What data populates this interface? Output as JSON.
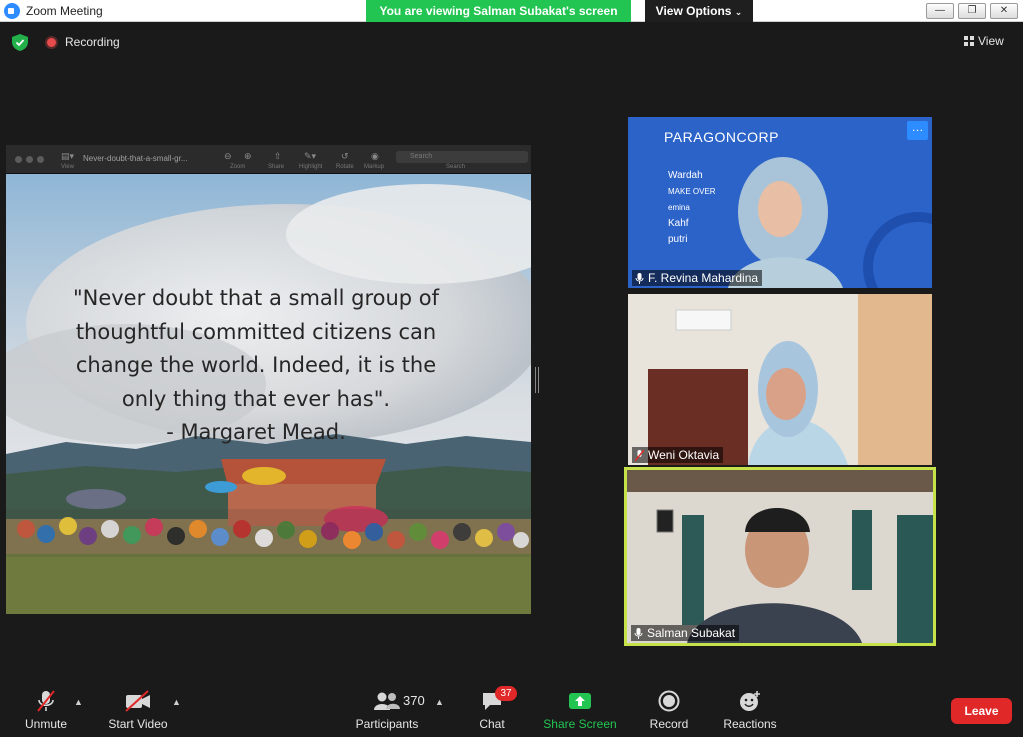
{
  "window": {
    "title": "Zoom Meeting",
    "banner": "You are viewing Salman Subakat's screen",
    "view_options": "View Options",
    "controls": {
      "minimize": "—",
      "restore": "❐",
      "close": "✕"
    }
  },
  "status": {
    "recording": "Recording",
    "view": "View"
  },
  "shared_screen": {
    "filename": "Never-doubt-that-a-small-gr...",
    "toolbar": [
      "View",
      "Zoom",
      "Share",
      "Highlight",
      "Rotate",
      "Markup"
    ],
    "search_placeholder": "Search",
    "search_label": "Search",
    "quote_lines": [
      "\"Never doubt that a small group of",
      "thoughtful committed citizens can",
      "change the world.  Indeed, it is the",
      "only thing that ever has\".",
      "- Margaret Mead."
    ]
  },
  "participants": [
    {
      "name": "F. Revina Mahardina",
      "brand": "PARAGONCORP",
      "brand_list": [
        "Wardah",
        "MAKE OVER",
        "emina",
        "Kahf",
        "putri"
      ]
    },
    {
      "name": "Weni Oktavia"
    },
    {
      "name": "Salman Subakat"
    }
  ],
  "toolbar": {
    "unmute": "Unmute",
    "start_video": "Start Video",
    "participants": "Participants",
    "participant_count": "370",
    "chat": "Chat",
    "chat_badge": "37",
    "share_screen": "Share Screen",
    "record": "Record",
    "reactions": "Reactions",
    "leave": "Leave"
  },
  "colors": {
    "share_green": "#23c552",
    "leave_red": "#e02828",
    "active_speaker": "#c6e24a",
    "zoom_blue": "#2d8cff"
  },
  "icons": [
    "shield-icon",
    "record-dot-icon",
    "grid-view-icon",
    "mic-muted-icon",
    "video-off-icon",
    "participants-icon",
    "chat-icon",
    "share-screen-icon",
    "record-icon",
    "reactions-icon"
  ]
}
